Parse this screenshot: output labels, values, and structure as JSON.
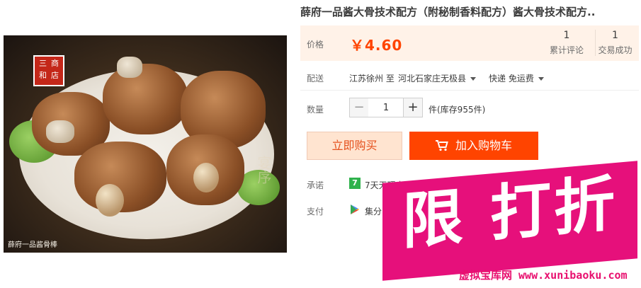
{
  "product": {
    "title": "薛府一品酱大骨技术配方（附秘制香料配方）酱大骨技术配方..",
    "image": {
      "seal_chars": [
        "三",
        "商",
        "和",
        "店"
      ],
      "caption": "薛府一品酱骨棒",
      "calligraphy": "宴序"
    }
  },
  "price": {
    "label": "价格",
    "value": "￥4.60"
  },
  "stats": {
    "reviews_count": "1",
    "reviews_label": "累计评论",
    "trades_count": "1",
    "trades_label": "交易成功"
  },
  "shipping": {
    "label": "配送",
    "from": "江苏徐州 至",
    "to": "河北石家庄无极县",
    "method": "快递 免运费"
  },
  "quantity": {
    "label": "数量",
    "minus": "−",
    "value": "1",
    "plus": "+",
    "stock": "件(库存955件)"
  },
  "actions": {
    "buy_now": "立即购买",
    "add_to_cart": "加入购物车"
  },
  "promise": {
    "label": "承诺",
    "icon_char": "7",
    "text": "7天无理由"
  },
  "payment": {
    "label": "支付",
    "text": "集分"
  },
  "overlay": {
    "badge_text": "限 打折",
    "watermark": "虚拟宝库网 www.xunibaoku.com"
  },
  "colors": {
    "price": "#ff4400",
    "cart_button": "#ff4400",
    "buy_button_bg": "#ffe4d0",
    "badge": "#e6107b"
  }
}
